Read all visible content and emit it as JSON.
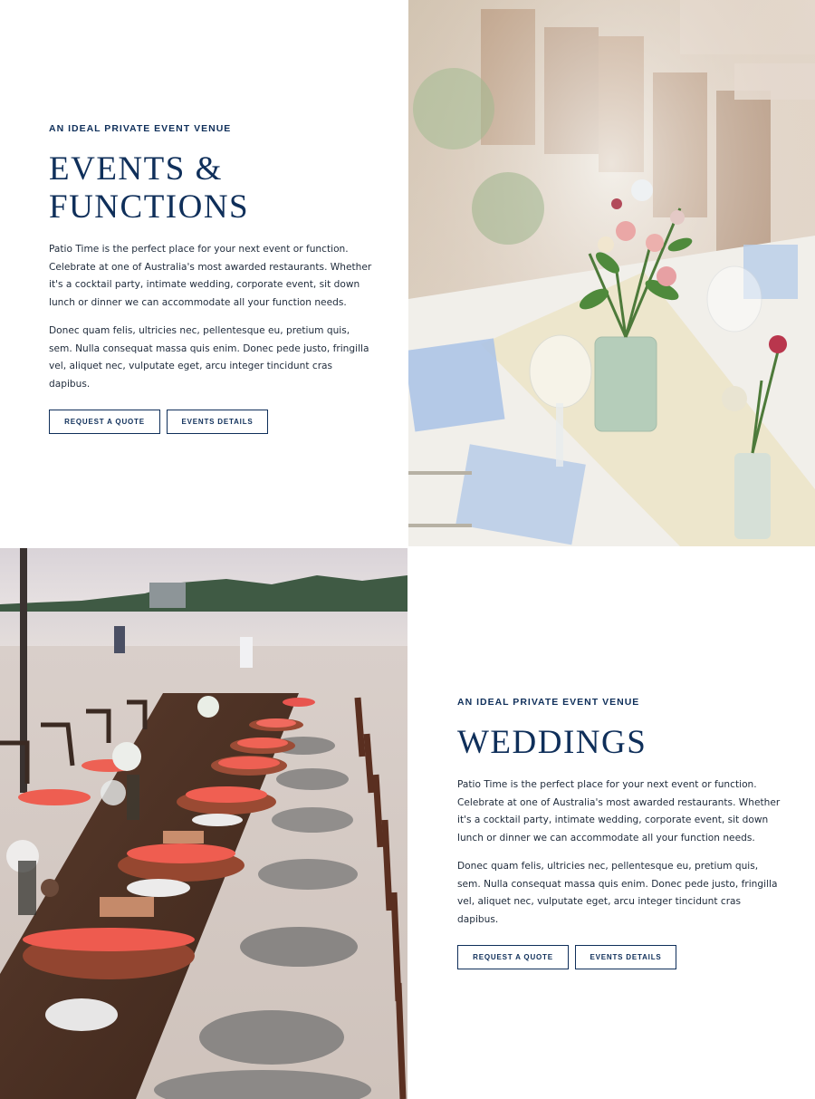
{
  "events": {
    "eyebrow": "AN IDEAL PRIVATE EVENT VENUE",
    "heading_line1": "EVENTS &",
    "heading_line2": "FUNCTIONS",
    "paragraph1": "Patio Time is the perfect place for your next event or function. Celebrate at one of Australia's most awarded restaurants. Whether it's a cocktail party, intimate wedding, corporate event, sit down lunch or dinner we can accommodate all your function needs.",
    "paragraph2": "Donec quam felis, ultricies nec, pellentesque eu, pretium quis, sem. Nulla consequat massa quis enim. Donec pede justo, fringilla vel, aliquet nec, vulputate eget, arcu integer tincidunt cras dapibus.",
    "quote_button": "REQUEST A QUOTE",
    "details_button": "EVENTS DETAILS"
  },
  "weddings": {
    "eyebrow": "AN IDEAL PRIVATE EVENT VENUE",
    "heading": "WEDDINGS",
    "paragraph1": "Patio Time is the perfect place for your next event or function. Celebrate at one of Australia's most awarded restaurants. Whether it's a cocktail party, intimate wedding, corporate event, sit down lunch or dinner we can accommodate all your function needs.",
    "paragraph2": "Donec quam felis, ultricies nec, pellentesque eu, pretium quis, sem. Nulla consequat massa quis enim. Donec pede justo, fringilla vel, aliquet nec, vulputate eget, arcu integer tincidunt cras dapibus.",
    "quote_button": "REQUEST A QUOTE",
    "details_button": "EVENTS DETAILS"
  },
  "colors": {
    "brand_navy": "#0f2f5a",
    "body_text": "#1e2a3a",
    "background": "#ffffff"
  }
}
